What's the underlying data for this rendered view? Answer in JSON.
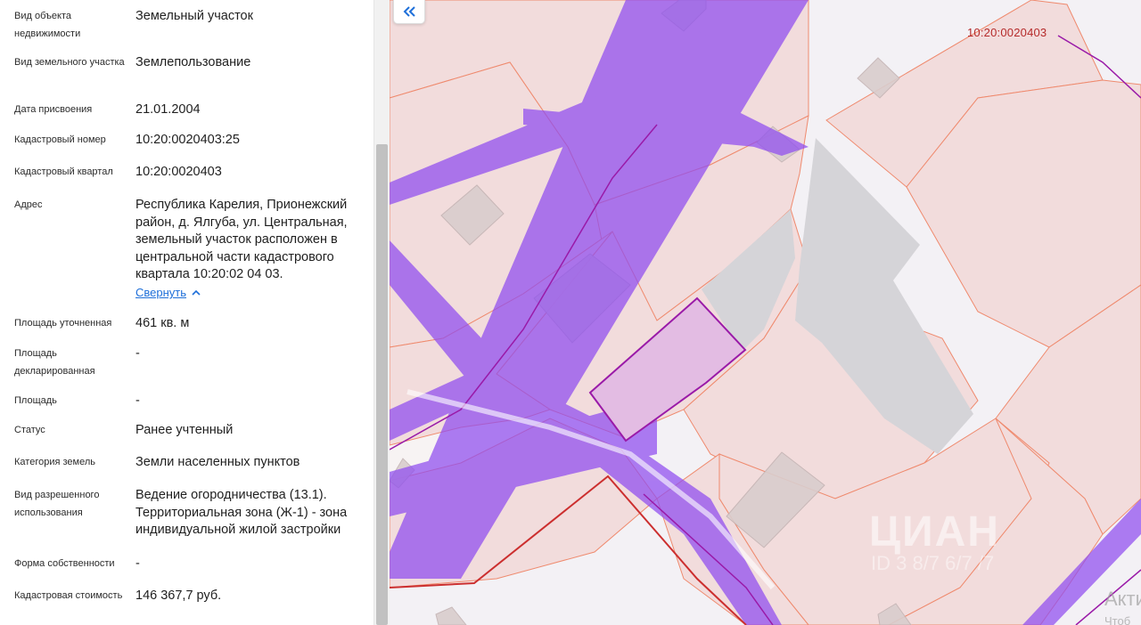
{
  "properties": [
    {
      "label": "Вид объекта недвижимости",
      "value": "Земельный участок"
    },
    {
      "label": "Вид земельного участка",
      "value": "Землепользование"
    },
    {
      "label": "Дата присвоения",
      "value": "21.01.2004"
    },
    {
      "label": "Кадастровый номер",
      "value": "10:20:0020403:25"
    },
    {
      "label": "Кадастровый квартал",
      "value": "10:20:0020403"
    },
    {
      "label": "Адрес",
      "value": "Республика Карелия, Прионежский район, д. Ялгуба, ул. Центральная, земельный участок расположен в центральной части кадастрового квартала 10:20:02 04 03."
    },
    {
      "label": "Площадь уточненная",
      "value": "461 кв. м"
    },
    {
      "label": "Площадь декларированная",
      "value": "-"
    },
    {
      "label": "Площадь",
      "value": "-"
    },
    {
      "label": "Статус",
      "value": "Ранее учтенный"
    },
    {
      "label": "Категория земель",
      "value": "Земли населенных пунктов"
    },
    {
      "label": "Вид разрешенного использования",
      "value": "Ведение огородничества (13.1). Территориальная зона (Ж-1) - зона индивидуальной жилой застройки"
    },
    {
      "label": "Форма собственности",
      "value": "-"
    },
    {
      "label": "Кадастровая стоимость",
      "value": "146 367,7 руб."
    }
  ],
  "address_collapse_link": "Свернуть",
  "map": {
    "quarter_label": "10:20:0020403",
    "watermark": "ЦИАН",
    "watermark_sub": "ID 3 8/7 6/7 /7",
    "activation": "Акти",
    "activation_sub": "Чтоб",
    "colors": {
      "background": "#f3f1f5",
      "parcel_fill": "#f2dcdc",
      "parcel_stroke": "#ef8a6e",
      "zone_purple": "#8f4cf0",
      "selected_fill": "#e3bce3",
      "selected_stroke": "#9a1aa8",
      "building": "#d2c8c8",
      "gray_area": "#d5d4d8",
      "quarter_line": "#cc2f2f"
    }
  },
  "icons": {
    "collapse_panel": "double-chevron-left-icon",
    "collapse_link": "chevron-up-icon"
  }
}
